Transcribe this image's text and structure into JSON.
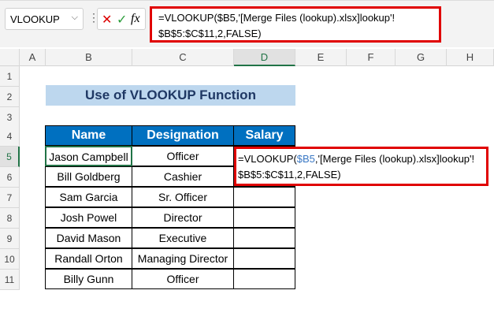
{
  "name_box": {
    "value": "VLOOKUP"
  },
  "formula_bar": {
    "cancel_icon": "✕",
    "enter_icon": "✓",
    "fx_label": "fx",
    "line1": "=VLOOKUP($B5,'[Merge Files (lookup).xlsx]lookup'!",
    "line2": "$B$5:$C$11,2,FALSE)"
  },
  "columns": [
    "A",
    "B",
    "C",
    "D",
    "E",
    "F",
    "G",
    "H"
  ],
  "rows": [
    "1",
    "2",
    "3",
    "4",
    "5",
    "6",
    "7",
    "8",
    "9",
    "10",
    "11"
  ],
  "title": "Use of VLOOKUP Function",
  "table": {
    "headers": [
      "Name",
      "Designation",
      "Salary"
    ],
    "rows": [
      [
        "Jason Campbell",
        "Officer"
      ],
      [
        "Bill Goldberg",
        "Cashier"
      ],
      [
        "Sam Garcia",
        "Sr. Officer"
      ],
      [
        "Josh Powel",
        "Director"
      ],
      [
        "David Mason",
        "Executive"
      ],
      [
        "Randall Orton",
        "Managing Director"
      ],
      [
        "Billy Gunn",
        "Officer"
      ]
    ]
  },
  "cell_edit": {
    "prefix": "=VLOOKUP(",
    "ref": "$B5",
    "rest": ",'[Merge Files (lookup).xlsx]lookup'!",
    "line2": "$B$5:$C$11,2,FALSE)"
  },
  "colors": {
    "accent": "#217346",
    "header_blue": "#0070c0",
    "title_bg": "#bdd7ee",
    "highlight": "#e00000"
  }
}
